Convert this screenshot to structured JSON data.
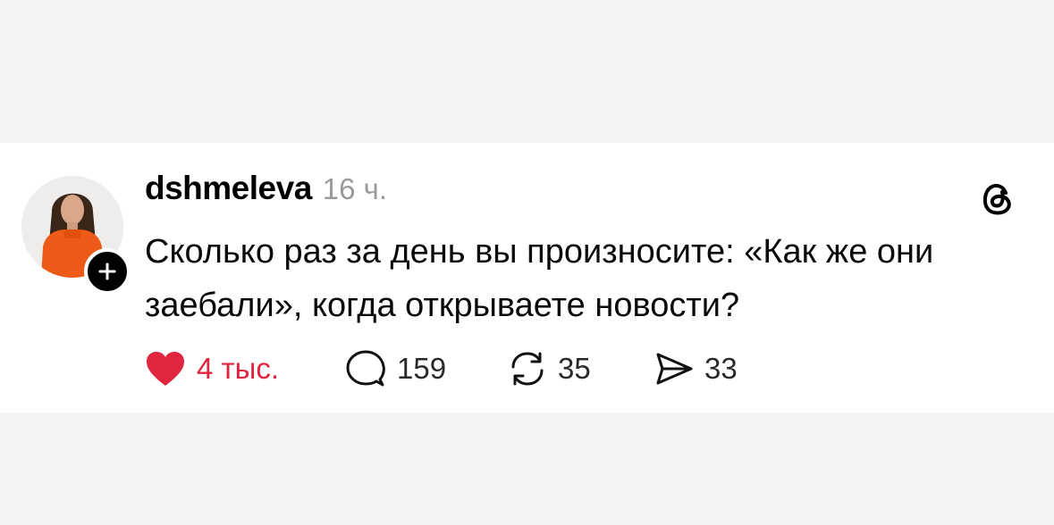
{
  "post": {
    "username": "dshmeleva",
    "time_ago": "16 ч.",
    "text": "Сколько раз за день вы произносите: «Как же они заебали», когда открываете новости?",
    "stats": {
      "likes": "4 тыс.",
      "replies": "159",
      "reposts": "35",
      "shares": "33"
    }
  },
  "icons": {
    "avatar": "profile-photo",
    "follow": "plus-icon",
    "brand": "threads-logo-icon",
    "like": "heart-icon",
    "reply": "comment-bubble-icon",
    "repost": "repost-arrows-icon",
    "share": "send-paper-plane-icon"
  },
  "colors": {
    "like_active": "#e0263f",
    "timestamp": "#9a9a9a",
    "text": "#0a0a0a",
    "background": "#f4f4f4",
    "card": "#ffffff"
  }
}
